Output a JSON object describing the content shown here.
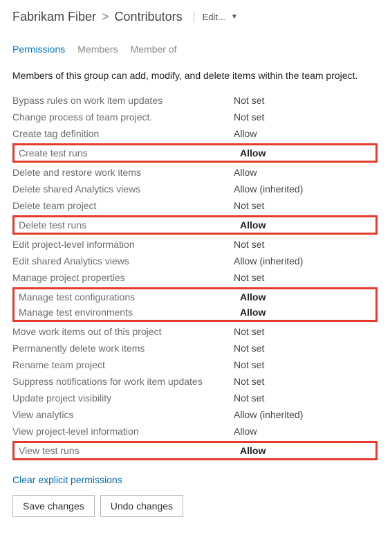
{
  "breadcrumb": {
    "project": "Fabrikam Fiber",
    "group": "Contributors",
    "edit_label": "Edit..."
  },
  "tabs": [
    {
      "label": "Permissions",
      "active": true
    },
    {
      "label": "Members",
      "active": false
    },
    {
      "label": "Member of",
      "active": false
    }
  ],
  "description": "Members of this group can add, modify, and delete items within the team project.",
  "permission_groups": [
    {
      "highlighted": false,
      "items": [
        {
          "label": "Bypass rules on work item updates",
          "value": "Not set",
          "bold": false
        },
        {
          "label": "Change process of team project.",
          "value": "Not set",
          "bold": false
        },
        {
          "label": "Create tag definition",
          "value": "Allow",
          "bold": false
        }
      ]
    },
    {
      "highlighted": true,
      "items": [
        {
          "label": "Create test runs",
          "value": "Allow",
          "bold": true
        }
      ]
    },
    {
      "highlighted": false,
      "items": [
        {
          "label": "Delete and restore work items",
          "value": "Allow",
          "bold": false
        },
        {
          "label": "Delete shared Analytics views",
          "value": "Allow (inherited)",
          "bold": false
        },
        {
          "label": "Delete team project",
          "value": "Not set",
          "bold": false
        }
      ]
    },
    {
      "highlighted": true,
      "items": [
        {
          "label": "Delete test runs",
          "value": "Allow",
          "bold": true
        }
      ]
    },
    {
      "highlighted": false,
      "items": [
        {
          "label": "Edit project-level information",
          "value": "Not set",
          "bold": false
        },
        {
          "label": "Edit shared Analytics views",
          "value": "Allow (inherited)",
          "bold": false
        },
        {
          "label": "Manage project properties",
          "value": "Not set",
          "bold": false
        }
      ]
    },
    {
      "highlighted": true,
      "items": [
        {
          "label": "Manage test configurations",
          "value": "Allow",
          "bold": true
        },
        {
          "label": "Manage test environments",
          "value": "Allow",
          "bold": true
        }
      ]
    },
    {
      "highlighted": false,
      "items": [
        {
          "label": "Move work items out of this project",
          "value": "Not set",
          "bold": false
        },
        {
          "label": "Permanently delete work items",
          "value": "Not set",
          "bold": false
        },
        {
          "label": "Rename team project",
          "value": "Not set",
          "bold": false
        },
        {
          "label": "Suppress notifications for work item updates",
          "value": "Not set",
          "bold": false
        },
        {
          "label": "Update project visibility",
          "value": "Not set",
          "bold": false
        },
        {
          "label": "View analytics",
          "value": "Allow (inherited)",
          "bold": false
        },
        {
          "label": "View project-level information",
          "value": "Allow",
          "bold": false
        }
      ]
    },
    {
      "highlighted": true,
      "items": [
        {
          "label": "View test runs",
          "value": "Allow",
          "bold": true
        }
      ]
    }
  ],
  "actions": {
    "clear_link": "Clear explicit permissions",
    "save_button": "Save changes",
    "undo_button": "Undo changes"
  }
}
